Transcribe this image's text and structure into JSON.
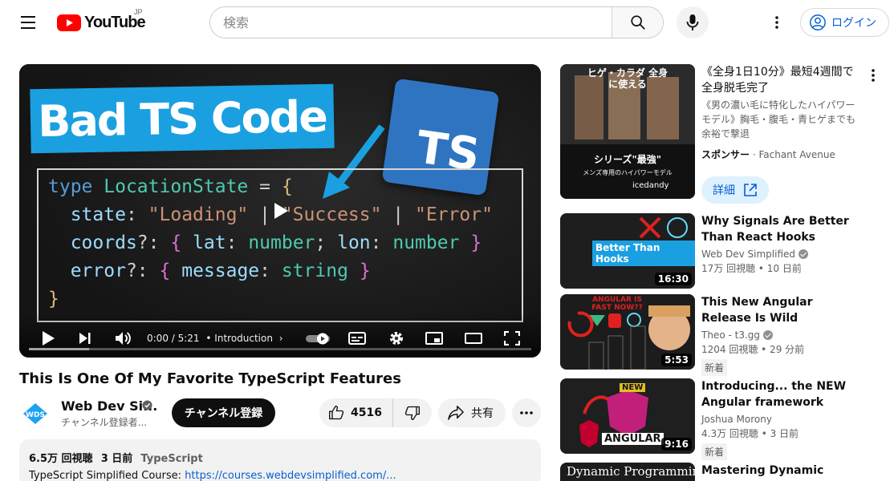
{
  "header": {
    "logo_text": "YouTube",
    "region": "JP",
    "search_placeholder": "検索",
    "login_label": "ログイン"
  },
  "player": {
    "thumbnail": {
      "banner_text": "Bad TS Code",
      "logo_text": "TS",
      "code_lines": [
        "type LocationState = {",
        "  state: \"Loading\" | \"Success\" | \"Error\"",
        "  coords?: { lat: number; lon: number }",
        "  error?: { message: string }",
        "}"
      ]
    },
    "time": "0:00 / 5:21",
    "chapter": "• Introduction",
    "chapter_arrow": "›"
  },
  "video": {
    "title": "This Is One Of My Favorite TypeScript Features",
    "channel": {
      "name": "Web Dev Si...",
      "subscribers": "チャンネル登録者...",
      "avatar_text": "WDS"
    },
    "subscribe_label": "チャンネル登録",
    "like_count": "4516",
    "share_label": "共有",
    "description": {
      "views": "6.5万 回視聴",
      "date": "3 日前",
      "tag": "TypeScript",
      "line_prefix": "TypeScript Simplified Course: ",
      "link": "https://courses.webdevsimplified.com/..."
    }
  },
  "sidebar": {
    "ad": {
      "thumb_caption_top": "ヒゲ・カラダ 全身に使える",
      "thumb_caption_mid": "シリーズ\"最強\"",
      "thumb_caption_bottom": "メンズ専用のハイパワーモデル",
      "thumb_brand": "icedandy",
      "title": "《全身1日10分》最短4週間で全身脱毛完了",
      "description": "《男の濃い毛に特化したハイパワーモデル》胸毛・腹毛・青ヒゲまでも余裕で撃退",
      "sponsor_label": "スポンサー",
      "sponsor_sep": " · ",
      "sponsor_name": "Fachant Avenue",
      "button_label": "詳細"
    },
    "items": [
      {
        "title": "Why Signals Are Better Than React Hooks",
        "channel": "Web Dev Simplified",
        "meta": "17万 回視聴 • 10 日前",
        "duration": "16:30",
        "thumb_text": "Better Than Hooks"
      },
      {
        "title": "This New Angular Release Is Wild",
        "channel": "Theo - t3.gg",
        "meta": "1204 回視聴 • 29 分前",
        "badge": "新着",
        "duration": "5:53",
        "thumb_text": "ANGULAR IS FAST NOW??"
      },
      {
        "title": "Introducing... the NEW Angular framework",
        "channel": "Joshua Morony",
        "meta": "4.3万 回視聴 • 3 日前",
        "badge": "新着",
        "duration": "9:16",
        "thumb_text_top": "NEW",
        "thumb_text": "ANGULAR"
      },
      {
        "title": "Mastering Dynamic",
        "thumb_text": "Dynamic Programming"
      }
    ]
  },
  "colors": {
    "brand_red": "#ff0000",
    "link_blue": "#065fd4",
    "ts_blue": "#2f74c0",
    "banner_cyan": "#1aa0e0"
  }
}
